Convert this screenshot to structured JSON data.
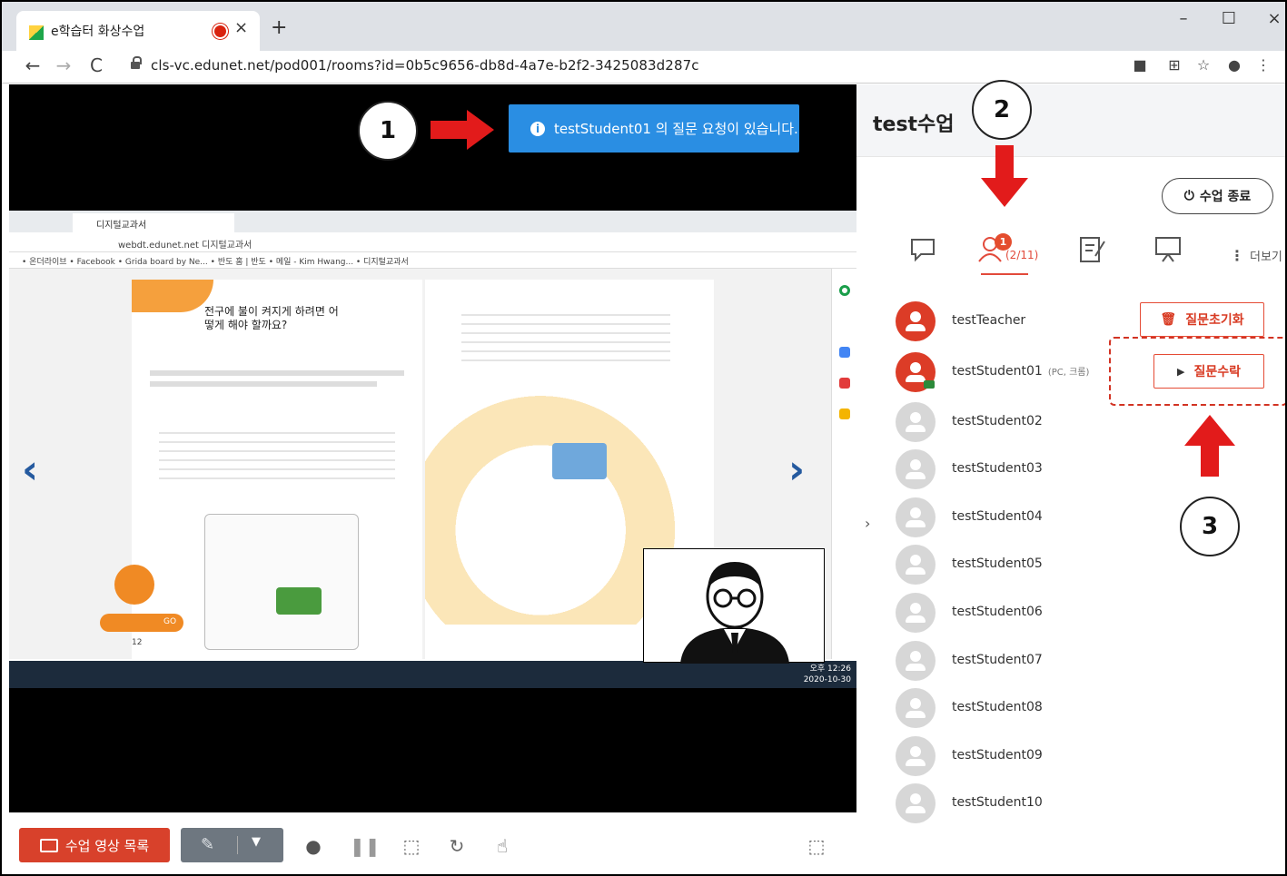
{
  "browser": {
    "tab_title": "e학습터 화상수업",
    "tab_close": "×",
    "new_tab": "+",
    "url": "cls-vc.edunet.net/pod001/rooms?id=0b5c9656-db8d-4a7e-b2f2-3425083d287c",
    "minimize": "–",
    "maximize": "☐",
    "close": "×"
  },
  "notification": {
    "text": "testStudent01 의 질문 요청이 있습니다."
  },
  "callouts": {
    "one": "1",
    "two": "2",
    "three": "3"
  },
  "shared_screen": {
    "tab_title": "디지털교과서",
    "url_text": "webdt.edunet.net 디지털교과서",
    "bookmarks": "• 온더라이브  • Facebook  • Grida board by Ne...  • 반도 홈 | 반도  • 메일 - Kim Hwang...  • 디지털교과서",
    "book_title": "전구에 불이 켜지게 하려면 어떻게 해야 할까요?",
    "page_number": "12",
    "clock_time": "오후 12:26",
    "clock_date": "2020-10-30",
    "go_label": "GO"
  },
  "controls": {
    "video_list_label": "수업 영상 목록"
  },
  "panel": {
    "title": "test수업",
    "end_class_label": "수업 종료",
    "participant_badge": "1",
    "participant_count": "(2/11)",
    "more_label": "더보기",
    "participants": [
      {
        "name": "testTeacher",
        "sub": ""
      },
      {
        "name": "testStudent01",
        "sub": "(PC, 크롬)"
      },
      {
        "name": "testStudent02",
        "sub": ""
      },
      {
        "name": "testStudent03",
        "sub": ""
      },
      {
        "name": "testStudent04",
        "sub": ""
      },
      {
        "name": "testStudent05",
        "sub": ""
      },
      {
        "name": "testStudent06",
        "sub": ""
      },
      {
        "name": "testStudent07",
        "sub": ""
      },
      {
        "name": "testStudent08",
        "sub": ""
      },
      {
        "name": "testStudent09",
        "sub": ""
      },
      {
        "name": "testStudent10",
        "sub": ""
      }
    ],
    "reset_question_label": "질문초기화",
    "accept_question_label": "질문수락"
  },
  "colors": {
    "accent": "#2a8ee3",
    "danger": "#dc3c27",
    "brand_orange": "#f08a24"
  }
}
